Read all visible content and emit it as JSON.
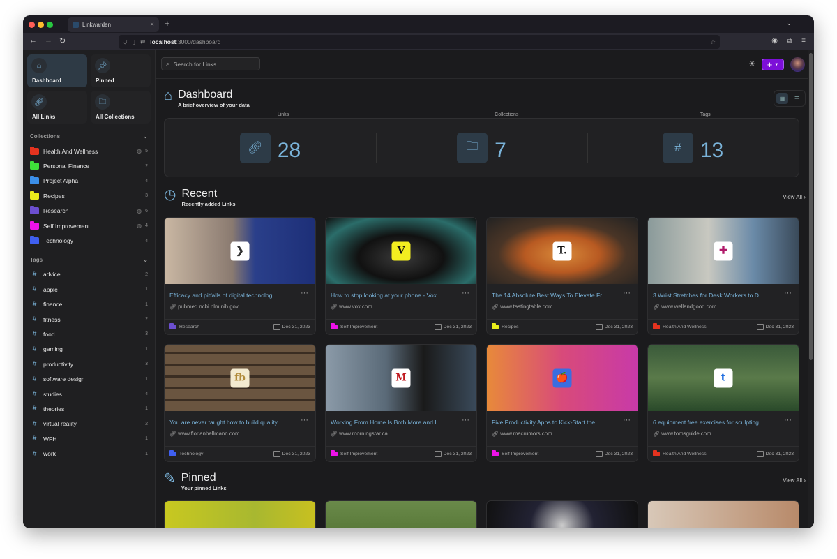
{
  "browser": {
    "tab_title": "Linkwarden",
    "url_host": "localhost",
    "url_path": ":3000/dashboard"
  },
  "sidebar": {
    "nav": [
      {
        "label": "Dashboard",
        "icon": "home-icon"
      },
      {
        "label": "Pinned",
        "icon": "pin-icon"
      },
      {
        "label": "All Links",
        "icon": "link-icon"
      },
      {
        "label": "All Collections",
        "icon": "folder-icon"
      }
    ],
    "collections_heading": "Collections",
    "collections": [
      {
        "name": "Health And Wellness",
        "count": "5",
        "public": true,
        "color": "#e5331f"
      },
      {
        "name": "Personal Finance",
        "count": "2",
        "public": false,
        "color": "#3fe03a"
      },
      {
        "name": "Project Alpha",
        "count": "4",
        "public": false,
        "color": "#3b8fe8"
      },
      {
        "name": "Recipes",
        "count": "3",
        "public": false,
        "color": "#e9ed1c"
      },
      {
        "name": "Research",
        "count": "6",
        "public": true,
        "color": "#6c4fd0"
      },
      {
        "name": "Self Improvement",
        "count": "4",
        "public": true,
        "color": "#ee12e8"
      },
      {
        "name": "Technology",
        "count": "4",
        "public": false,
        "color": "#3f5ff0"
      }
    ],
    "tags_heading": "Tags",
    "tags": [
      {
        "name": "advice",
        "count": "2"
      },
      {
        "name": "apple",
        "count": "1"
      },
      {
        "name": "finance",
        "count": "1"
      },
      {
        "name": "fitness",
        "count": "2"
      },
      {
        "name": "food",
        "count": "3"
      },
      {
        "name": "gaming",
        "count": "1"
      },
      {
        "name": "productivity",
        "count": "3"
      },
      {
        "name": "software design",
        "count": "1"
      },
      {
        "name": "studies",
        "count": "4"
      },
      {
        "name": "theories",
        "count": "1"
      },
      {
        "name": "virtual reality",
        "count": "2"
      },
      {
        "name": "WFH",
        "count": "1"
      },
      {
        "name": "work",
        "count": "1"
      }
    ]
  },
  "topbar": {
    "search_placeholder": "Search for Links"
  },
  "dashboard": {
    "title": "Dashboard",
    "subtitle": "A brief overview of your data",
    "stats": [
      {
        "label": "Links",
        "value": "28",
        "icon": "link-icon"
      },
      {
        "label": "Collections",
        "value": "7",
        "icon": "folder-icon"
      },
      {
        "label": "Tags",
        "value": "13",
        "icon": "hash-icon"
      }
    ]
  },
  "recent": {
    "title": "Recent",
    "subtitle": "Recently added Links",
    "view_all": "View All",
    "links": [
      {
        "title": "Efficacy and pitfalls of digital technologi...",
        "url": "pubmed.ncbi.nlm.nih.gov",
        "collection": "Research",
        "color": "#6c4fd0",
        "date": "Dec 31, 2023",
        "favicon": "❯"
      },
      {
        "title": "How to stop looking at your phone - Vox",
        "url": "www.vox.com",
        "collection": "Self Improvement",
        "color": "#ee12e8",
        "date": "Dec 31, 2023",
        "favicon": "V"
      },
      {
        "title": "The 14 Absolute Best Ways To Elevate Fr...",
        "url": "www.tastingtable.com",
        "collection": "Recipes",
        "color": "#e9ed1c",
        "date": "Dec 31, 2023",
        "favicon": "T."
      },
      {
        "title": "3 Wrist Stretches for Desk Workers to D...",
        "url": "www.wellandgood.com",
        "collection": "Health And Wellness",
        "color": "#e5331f",
        "date": "Dec 31, 2023",
        "favicon": "✚"
      },
      {
        "title": "You are never taught how to build quality...",
        "url": "www.florianbellmann.com",
        "collection": "Technology",
        "color": "#3f5ff0",
        "date": "Dec 31, 2023",
        "favicon": "fb"
      },
      {
        "title": "Working From Home Is Both More and L...",
        "url": "www.morningstar.ca",
        "collection": "Self Improvement",
        "color": "#ee12e8",
        "date": "Dec 31, 2023",
        "favicon": "M"
      },
      {
        "title": "Five Productivity Apps to Kick-Start the ...",
        "url": "www.macrumors.com",
        "collection": "Self Improvement",
        "color": "#ee12e8",
        "date": "Dec 31, 2023",
        "favicon": "🍎"
      },
      {
        "title": "6 equipment free exercises for sculpting ...",
        "url": "www.tomsguide.com",
        "collection": "Health And Wellness",
        "color": "#e5331f",
        "date": "Dec 31, 2023",
        "favicon": "t"
      }
    ]
  },
  "pinned": {
    "title": "Pinned",
    "subtitle": "Your pinned Links",
    "view_all": "View All"
  },
  "colors": {
    "accent": "#7ab3d9",
    "primary_button": "#7c0fd8"
  }
}
